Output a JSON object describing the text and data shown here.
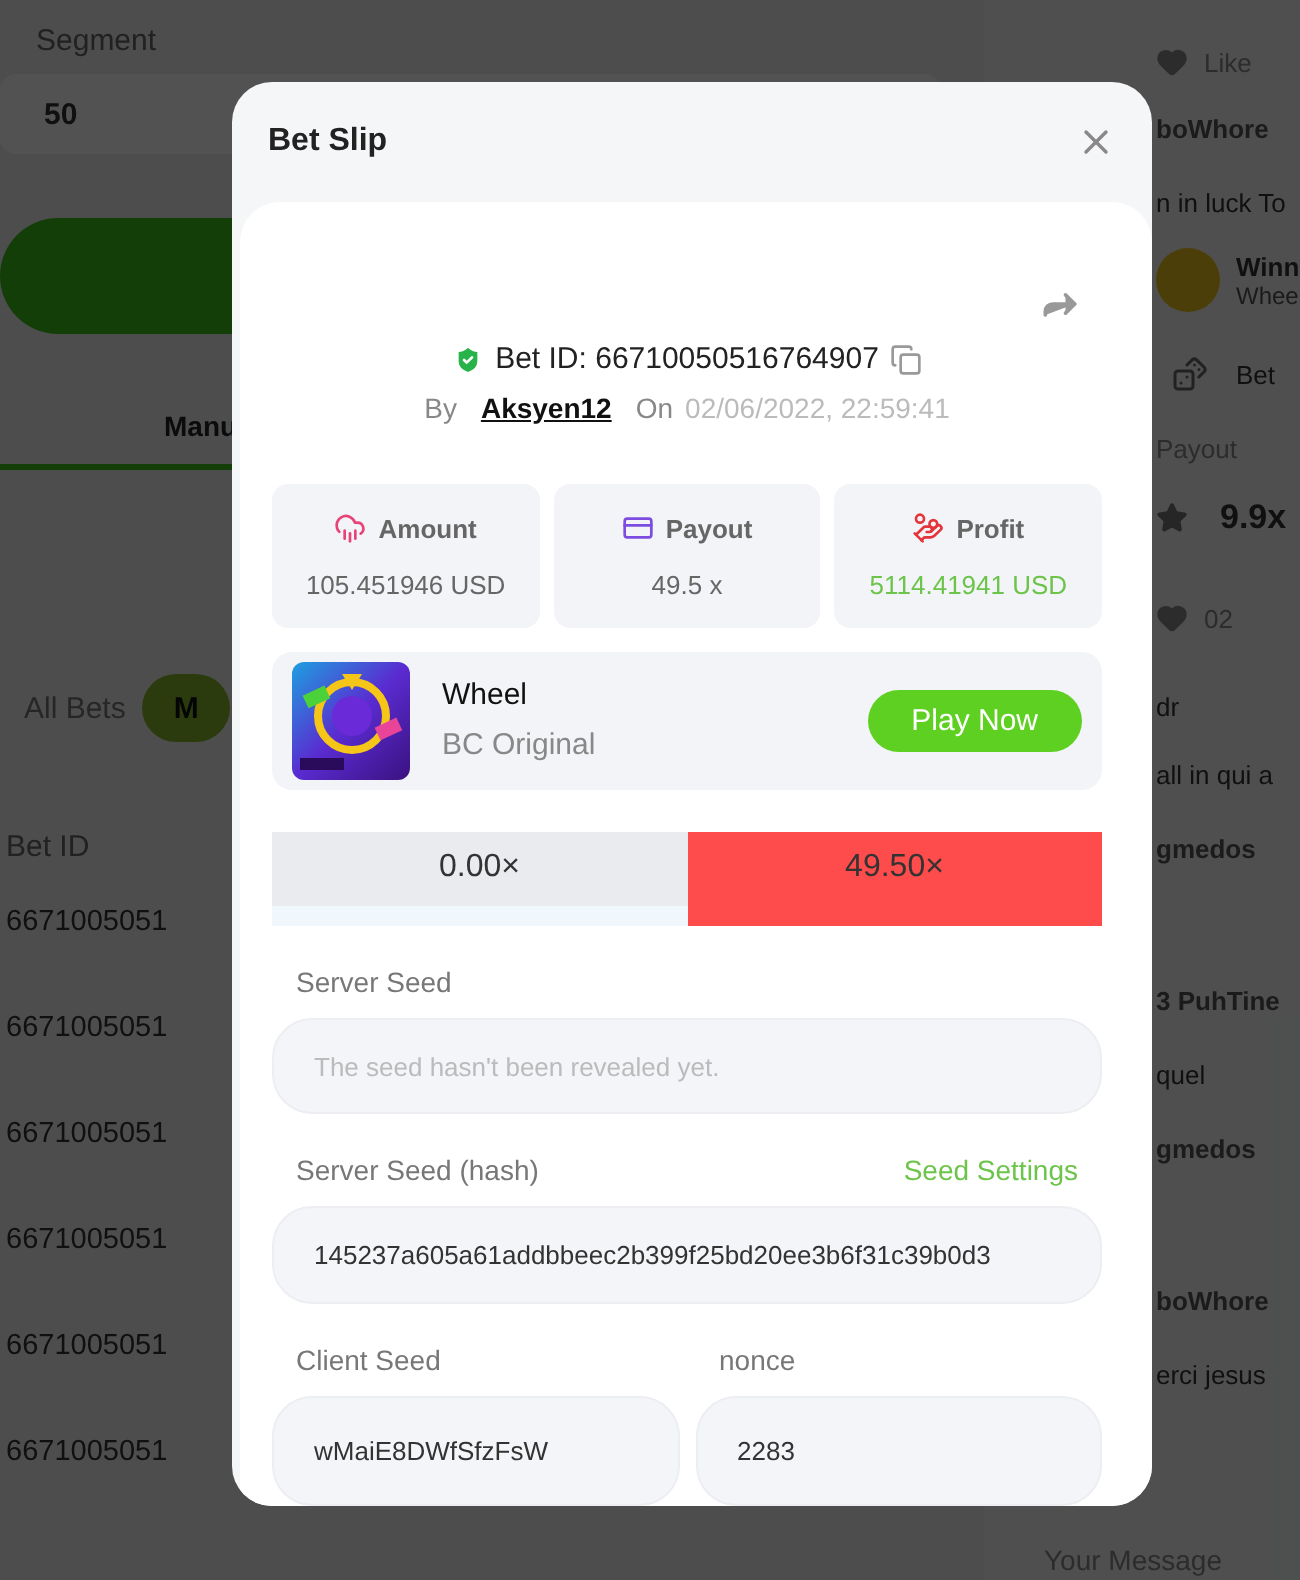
{
  "background": {
    "segment": {
      "label": "Segment",
      "value": "50"
    },
    "mode_tab": {
      "label": "Manu",
      "selected": true
    },
    "bet_filters": [
      {
        "label": "All Bets",
        "selected": false
      },
      {
        "label": "M",
        "selected": true
      }
    ],
    "table": {
      "columns": [
        "Bet ID"
      ],
      "rows": [
        [
          "6671005051"
        ],
        [
          "6671005051"
        ],
        [
          "6671005051"
        ],
        [
          "6671005051"
        ],
        [
          "6671005051"
        ],
        [
          "6671005051"
        ]
      ]
    },
    "chat": [
      {
        "kind": "like",
        "text": "Like"
      },
      {
        "kind": "name",
        "text": "boWhore"
      },
      {
        "kind": "text",
        "text": "n in luck To"
      },
      {
        "kind": "win",
        "text": "Winn",
        "sub": "Whee"
      },
      {
        "kind": "bet",
        "text": "Bet"
      },
      {
        "kind": "label",
        "text": "Payout"
      },
      {
        "kind": "payout",
        "text": "9.9x"
      },
      {
        "kind": "likes",
        "text": "02"
      },
      {
        "kind": "text",
        "text": "dr"
      },
      {
        "kind": "text",
        "text": "all in qui a"
      },
      {
        "kind": "name",
        "text": "gmedos"
      },
      {
        "kind": "spacer"
      },
      {
        "kind": "name",
        "text": "3 PuhTine"
      },
      {
        "kind": "text",
        "text": "quel"
      },
      {
        "kind": "name",
        "text": "gmedos"
      },
      {
        "kind": "spacer"
      },
      {
        "kind": "name",
        "text": "boWhore"
      },
      {
        "kind": "text",
        "text": "erci jesus"
      }
    ],
    "message_placeholder": "Your Message"
  },
  "modal": {
    "title": "Bet Slip",
    "bet_id": "Bet ID: 66710050516764907",
    "by_label": "By",
    "user": "Aksyen12",
    "on_label": "On",
    "date": "02/06/2022, 22:59:41",
    "stats": [
      {
        "kind": "amount",
        "label": "Amount",
        "value": "105.451946 USD"
      },
      {
        "kind": "payout",
        "label": "Payout",
        "value": "49.5 x"
      },
      {
        "kind": "profit",
        "label": "Profit",
        "value": "5114.41941 USD"
      }
    ],
    "game": {
      "name": "Wheel",
      "provider": "BC Original",
      "button": "Play Now"
    },
    "results": [
      {
        "label": "0.00×",
        "selected": false
      },
      {
        "label": "49.50×",
        "selected": true
      }
    ],
    "server_seed": {
      "label": "Server Seed",
      "placeholder": "The seed hasn't been revealed yet."
    },
    "server_seed_hash": {
      "label": "Server Seed (hash)",
      "link": "Seed Settings",
      "value": "145237a605a61addbbeec2b399f25bd20ee3b6f31c39b0d3"
    },
    "client_seed": {
      "label": "Client Seed",
      "value": "wMaiE8DWfSfzFsW"
    },
    "nonce": {
      "label": "nonce",
      "value": "2283"
    }
  }
}
